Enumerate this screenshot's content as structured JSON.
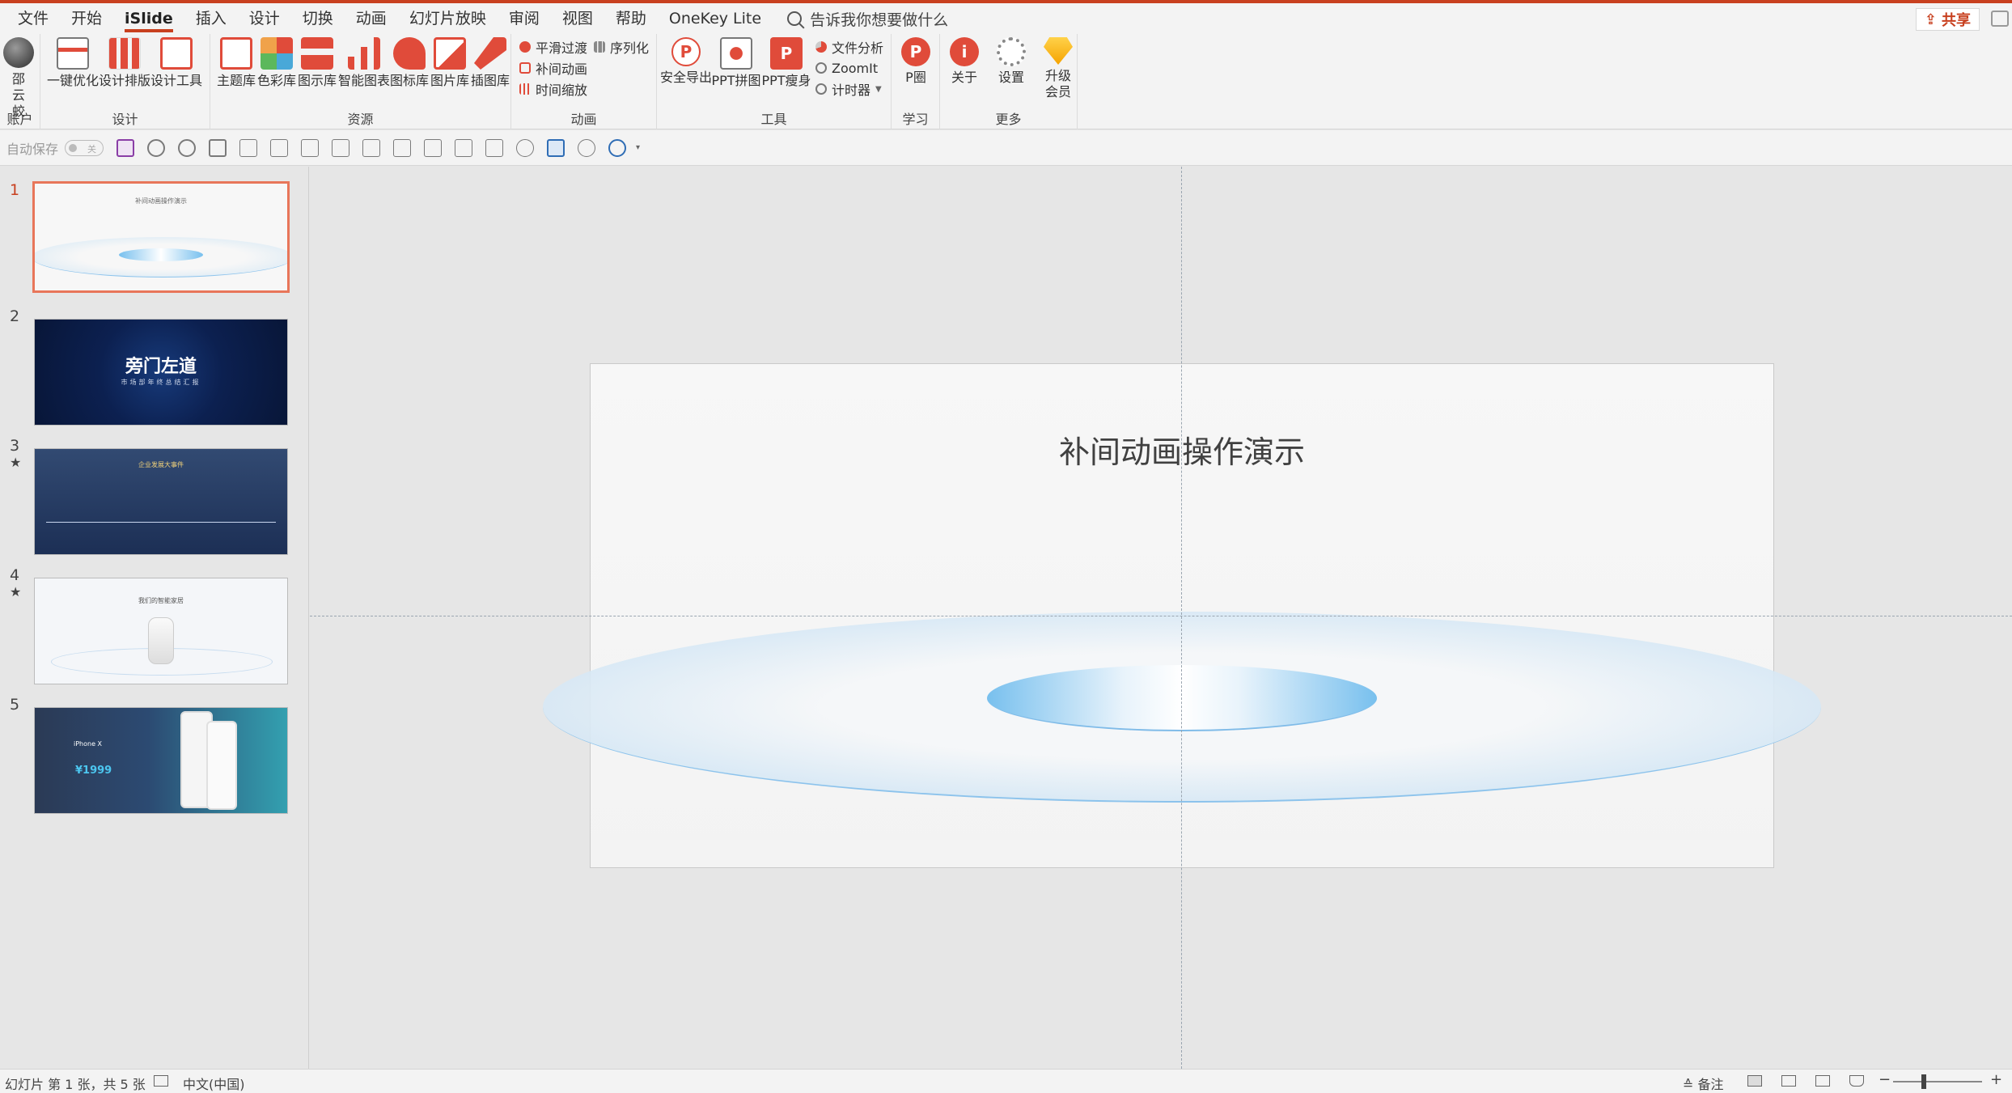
{
  "menu": {
    "items": [
      "文件",
      "开始",
      "iSlide",
      "插入",
      "设计",
      "切换",
      "动画",
      "幻灯片放映",
      "审阅",
      "视图",
      "帮助",
      "OneKey Lite"
    ],
    "active": "iSlide",
    "tell_me": "告诉我你想要做什么",
    "share": "共享"
  },
  "ribbon": {
    "account": {
      "label": "账户",
      "user": "邵云蛟"
    },
    "design": {
      "label": "设计",
      "buttons": [
        "一键优化",
        "设计排版",
        "设计工具"
      ]
    },
    "resources": {
      "label": "资源",
      "buttons": [
        "主题库",
        "色彩库",
        "图示库",
        "智能图表",
        "图标库",
        "图片库",
        "插图库"
      ]
    },
    "animation": {
      "label": "动画",
      "buttons": [
        "平滑过渡",
        "补间动画",
        "时间缩放",
        "序列化"
      ]
    },
    "tools": {
      "label": "工具",
      "buttons": [
        "安全导出",
        "PPT拼图",
        "PPT瘦身",
        "文件分析",
        "ZoomIt",
        "计时器"
      ]
    },
    "learn": {
      "label": "学习",
      "buttons": [
        "P圈"
      ]
    },
    "more": {
      "label": "更多",
      "buttons": [
        "关于",
        "设置",
        "升级会员"
      ]
    }
  },
  "qat": {
    "autosave_label": "自动保存",
    "toggle": "关"
  },
  "slides": [
    {
      "num": "1",
      "title": "补间动画操作演示",
      "starred": false
    },
    {
      "num": "2",
      "title": "旁门左道",
      "subtitle": "市场部年终总结汇报",
      "starred": false
    },
    {
      "num": "3",
      "title": "企业发展大事件",
      "starred": true
    },
    {
      "num": "4",
      "title": "我们的智能家居",
      "starred": true
    },
    {
      "num": "5",
      "title": "iPhone X",
      "price": "¥1999",
      "starred": false
    }
  ],
  "current_slide": {
    "title": "补间动画操作演示"
  },
  "status": {
    "slide_info": "幻灯片 第 1 张，共 5 张",
    "language": "中文(中国)",
    "notes": "备注"
  },
  "colors": {
    "accent": "#c8401f",
    "selected_thumb": "#e8765a",
    "ellipse_blue": "#8cc3ec"
  }
}
